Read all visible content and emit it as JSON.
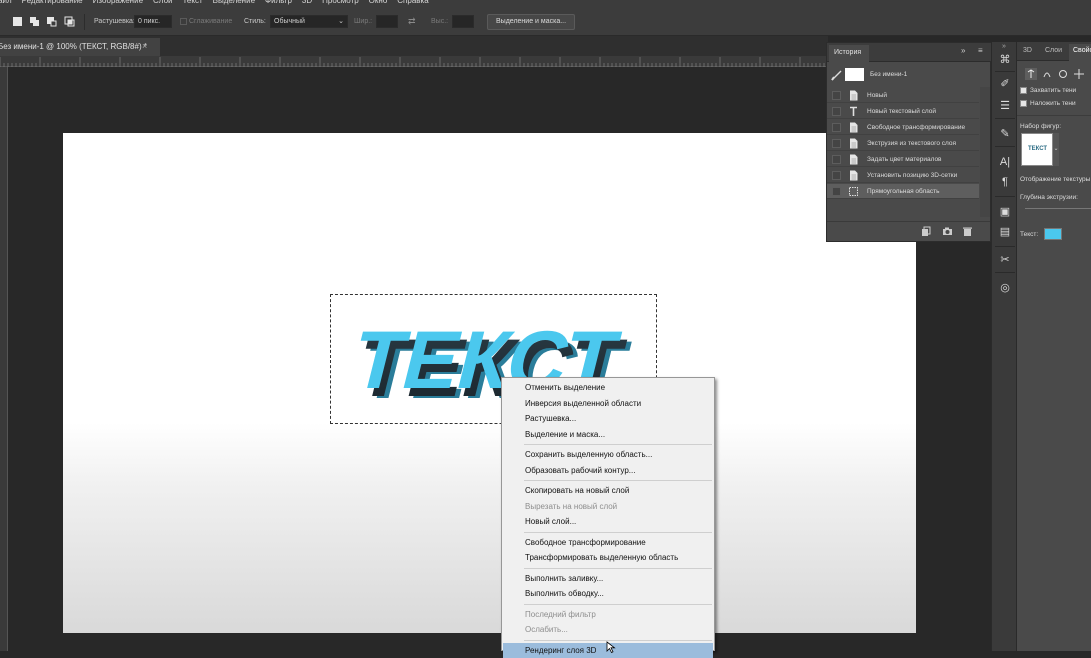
{
  "menubar": {
    "items": [
      "Файл",
      "Редактирование",
      "Изображение",
      "Слой",
      "Текст",
      "Выделение",
      "Фильтр",
      "3D",
      "Просмотр",
      "Окно",
      "Справка"
    ]
  },
  "options": {
    "feather_label": "Растушевка:",
    "feather_value": "0 пикс.",
    "antialias_label": "Сглаживание",
    "style_label": "Стиль:",
    "style_value": "Обычный",
    "width_label": "Шир.:",
    "height_label": "Выс.:",
    "refine_button": "Выделение и маска..."
  },
  "document_tab": {
    "title": "Без имени-1 @ 100% (ТЕКСТ, RGB/8#) *",
    "close": "×"
  },
  "canvas": {
    "text_3d": "ТЕКСТ",
    "text_color": "#4bc8ee"
  },
  "history": {
    "title": "История",
    "collapse": "»",
    "snapshot": "Без имени-1",
    "items": [
      {
        "label": "Новый",
        "icon": "document-icon"
      },
      {
        "label": "Новый текстовый слой",
        "icon": "text-tool-icon"
      },
      {
        "label": "Свободное трансформирование",
        "icon": "document-icon"
      },
      {
        "label": "Экструзия из текстового слоя",
        "icon": "document-icon"
      },
      {
        "label": "Задать цвет материалов",
        "icon": "document-icon"
      },
      {
        "label": "Установить позицию 3D-сетки",
        "icon": "document-icon"
      },
      {
        "label": "Прямоугольная область",
        "icon": "marquee-icon",
        "active": true
      }
    ]
  },
  "properties": {
    "tabs": [
      "3D",
      "Слои",
      "Свойства"
    ],
    "cast_shadows": "Захватить тени",
    "receive_shadows": "Наложить тени",
    "shape_preset": "Набор фигур:",
    "texture_mapping": "Отображение текстуры",
    "extrusion_depth": "Глубина экструзии:",
    "text_label": "Текст:",
    "text_swatch": "#4bc8ee",
    "preset_thumb_text": "ТЕКСТ"
  },
  "context_menu": {
    "items": [
      {
        "label": "Отменить выделение",
        "disabled": false
      },
      {
        "label": "Инверсия выделенной области",
        "disabled": false
      },
      {
        "label": "Растушевка...",
        "disabled": false
      },
      {
        "label": "Выделение и маска...",
        "disabled": false
      },
      {
        "sep": true
      },
      {
        "label": "Сохранить выделенную область...",
        "disabled": false
      },
      {
        "label": "Образовать рабочий контур...",
        "disabled": false
      },
      {
        "sep": true
      },
      {
        "label": "Скопировать на новый слой",
        "disabled": false
      },
      {
        "label": "Вырезать на новый слой",
        "disabled": true
      },
      {
        "label": "Новый слой...",
        "disabled": false
      },
      {
        "sep": true
      },
      {
        "label": "Свободное трансформирование",
        "disabled": false
      },
      {
        "label": "Трансформировать выделенную область",
        "disabled": false
      },
      {
        "sep": true
      },
      {
        "label": "Выполнить заливку...",
        "disabled": false
      },
      {
        "label": "Выполнить обводку...",
        "disabled": false
      },
      {
        "sep": true
      },
      {
        "label": "Последний фильтр",
        "disabled": true
      },
      {
        "label": "Ослабить...",
        "disabled": true
      },
      {
        "sep": true
      },
      {
        "label": "Рендеринг слоя 3D",
        "disabled": false,
        "highlighted": true
      }
    ]
  }
}
